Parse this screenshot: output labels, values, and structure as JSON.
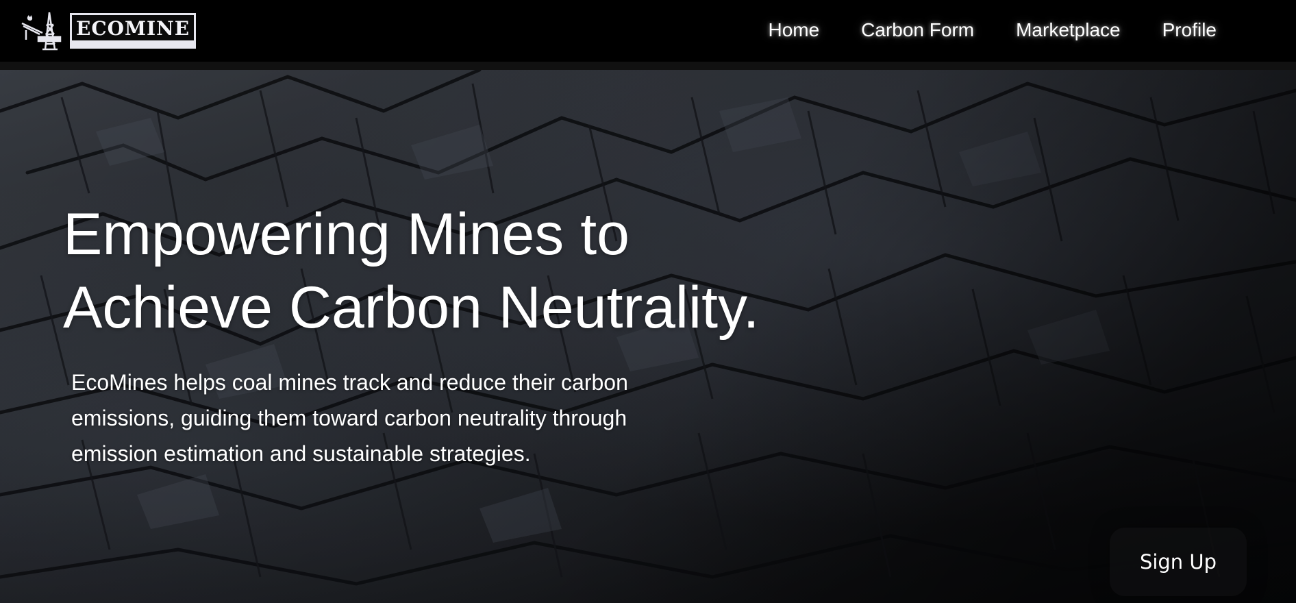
{
  "brand": {
    "name": "ECOMINE",
    "icon": "oil-rig-icon"
  },
  "nav": {
    "items": [
      {
        "label": "Home"
      },
      {
        "label": "Carbon Form"
      },
      {
        "label": "Marketplace"
      },
      {
        "label": "Profile"
      }
    ]
  },
  "hero": {
    "title_line1": "Empowering Mines to",
    "title_line2": "Achieve Carbon Neutrality.",
    "description": "EcoMines helps coal mines track and reduce their carbon emissions, guiding them toward carbon neutrality through emission estimation and sustainable strategies.",
    "background": "dark-coal-rock-image"
  },
  "cta": {
    "signup_label": "Sign Up"
  },
  "colors": {
    "navbar_bg": "#000000",
    "text": "#ffffff",
    "hero_dark": "#1d1f24"
  }
}
